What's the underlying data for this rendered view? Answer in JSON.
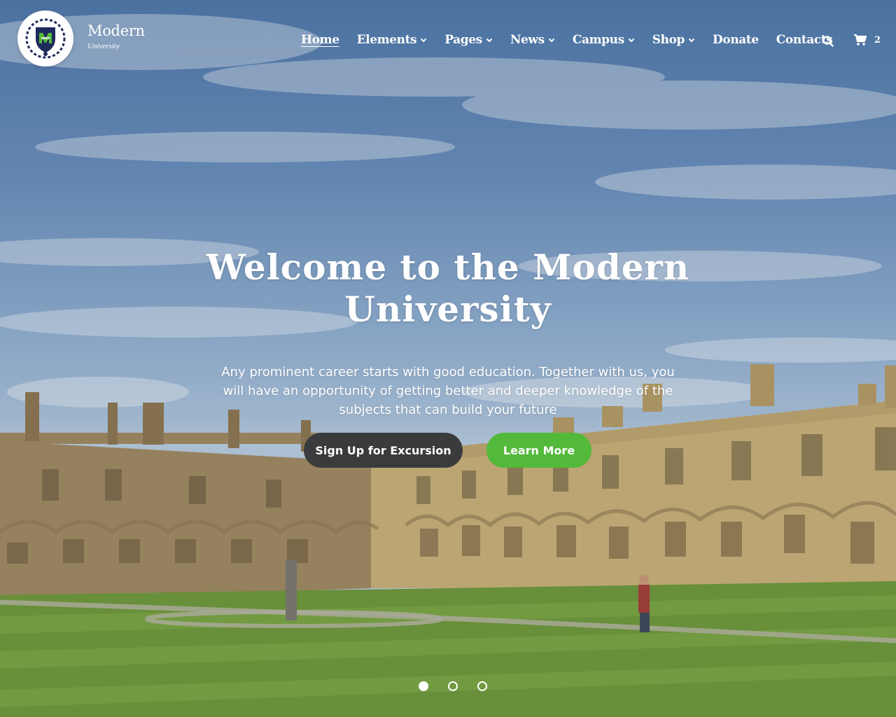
{
  "brand": {
    "name": "Modern",
    "tagline": "University",
    "logo_icon": "crest-logo-icon"
  },
  "nav": {
    "items": [
      {
        "label": "Home",
        "active": true,
        "has_dropdown": false
      },
      {
        "label": "Elements",
        "active": false,
        "has_dropdown": true
      },
      {
        "label": "Pages",
        "active": false,
        "has_dropdown": true
      },
      {
        "label": "News",
        "active": false,
        "has_dropdown": true
      },
      {
        "label": "Campus",
        "active": false,
        "has_dropdown": true
      },
      {
        "label": "Shop",
        "active": false,
        "has_dropdown": true
      },
      {
        "label": "Donate",
        "active": false,
        "has_dropdown": false
      },
      {
        "label": "Contacts",
        "active": false,
        "has_dropdown": false
      }
    ],
    "search_icon": "search-icon",
    "cart_icon": "cart-icon",
    "cart_count": "2"
  },
  "hero": {
    "title": "Welcome to the Modern University",
    "text": "Any prominent career starts with good education. Together with us, you will have an opportunity of getting better and deeper knowledge of the subjects that can build your future",
    "primary_button": "Sign Up for Excursion",
    "secondary_button": "Learn More",
    "slides_total": 3,
    "slide_active": 1
  },
  "colors": {
    "accent_green": "#53b93a",
    "dark_button": "#3a3b3d",
    "logo_navy": "#1f2a5c"
  }
}
